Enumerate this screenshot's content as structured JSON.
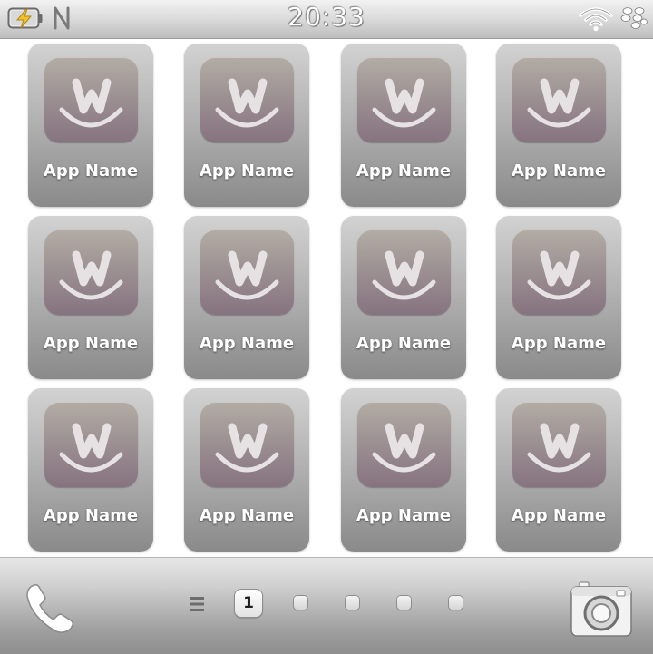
{
  "status_bar": {
    "time": "20:33",
    "battery_icon": "battery-charging-icon",
    "nfc_icon": "nfc-icon",
    "wifi_icon": "wifi-icon",
    "brand_icon": "blackberry-logo-icon"
  },
  "apps": [
    {
      "label": "App Name",
      "icon": "w-smile-app-icon"
    },
    {
      "label": "App Name",
      "icon": "w-smile-app-icon"
    },
    {
      "label": "App Name",
      "icon": "w-smile-app-icon"
    },
    {
      "label": "App Name",
      "icon": "w-smile-app-icon"
    },
    {
      "label": "App Name",
      "icon": "w-smile-app-icon"
    },
    {
      "label": "App Name",
      "icon": "w-smile-app-icon"
    },
    {
      "label": "App Name",
      "icon": "w-smile-app-icon"
    },
    {
      "label": "App Name",
      "icon": "w-smile-app-icon"
    },
    {
      "label": "App Name",
      "icon": "w-smile-app-icon"
    },
    {
      "label": "App Name",
      "icon": "w-smile-app-icon"
    },
    {
      "label": "App Name",
      "icon": "w-smile-app-icon"
    },
    {
      "label": "App Name",
      "icon": "w-smile-app-icon"
    }
  ],
  "dock": {
    "phone_icon": "phone-icon",
    "menu_icon": "menu-icon",
    "current_page": "1",
    "total_pages": 5,
    "camera_icon": "camera-icon"
  },
  "colors": {
    "tile_top": "#d2d2d2",
    "tile_bottom": "#8a8a8a",
    "icon_top": "#b3ada5",
    "icon_bottom": "#86737f",
    "label": "#ffffff"
  }
}
